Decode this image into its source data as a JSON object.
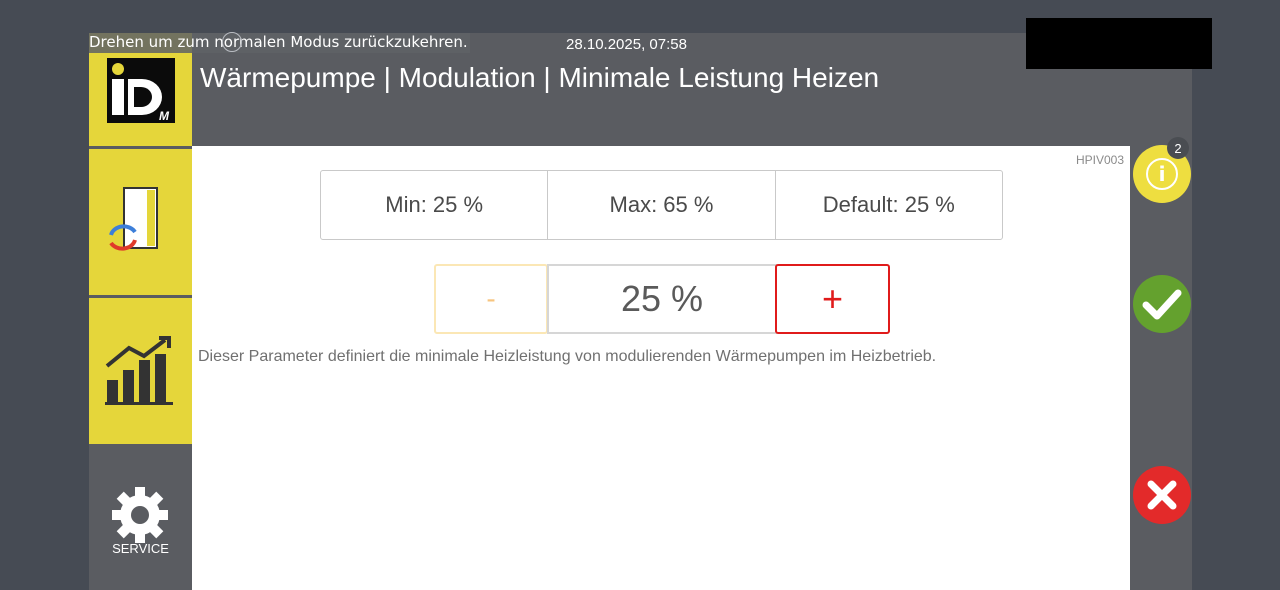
{
  "overlay": {
    "rotate_hint": "Drehen um zum normalen Modus zurückzukehren."
  },
  "header": {
    "datetime": "28.10.2025, 07:58",
    "title": "Wärmepumpe | Modulation | Minimale Leistung Heizen"
  },
  "sidebar": {
    "items": [
      {
        "name": "logo",
        "icon": "idm-logo"
      },
      {
        "name": "heat-pump",
        "icon": "heat-pump-cycle-icon"
      },
      {
        "name": "statistics",
        "icon": "bar-chart-trend-icon"
      },
      {
        "name": "service",
        "icon": "gear-icon",
        "label": "SERVICE"
      }
    ]
  },
  "parameter": {
    "code": "HPIV003",
    "min_label": "Min: 25 %",
    "max_label": "Max: 65 %",
    "default_label": "Default: 25 %",
    "decrement_label": "-",
    "value_display": "25 %",
    "increment_label": "+",
    "description": "Dieser Parameter definiert die minimale Heizleistung von modulierenden Wärmepumpen im Heizbetrieb."
  },
  "actions": {
    "info_glyph": "i",
    "info_badge": "2",
    "confirm_icon": "checkmark-icon",
    "cancel_icon": "close-icon"
  },
  "colors": {
    "sidebar_accent": "#e5d63a",
    "header_bg": "#5a5c61",
    "plus_red": "#e01b1b",
    "ok_green": "#64a12e",
    "cancel_red": "#e32a2a"
  }
}
